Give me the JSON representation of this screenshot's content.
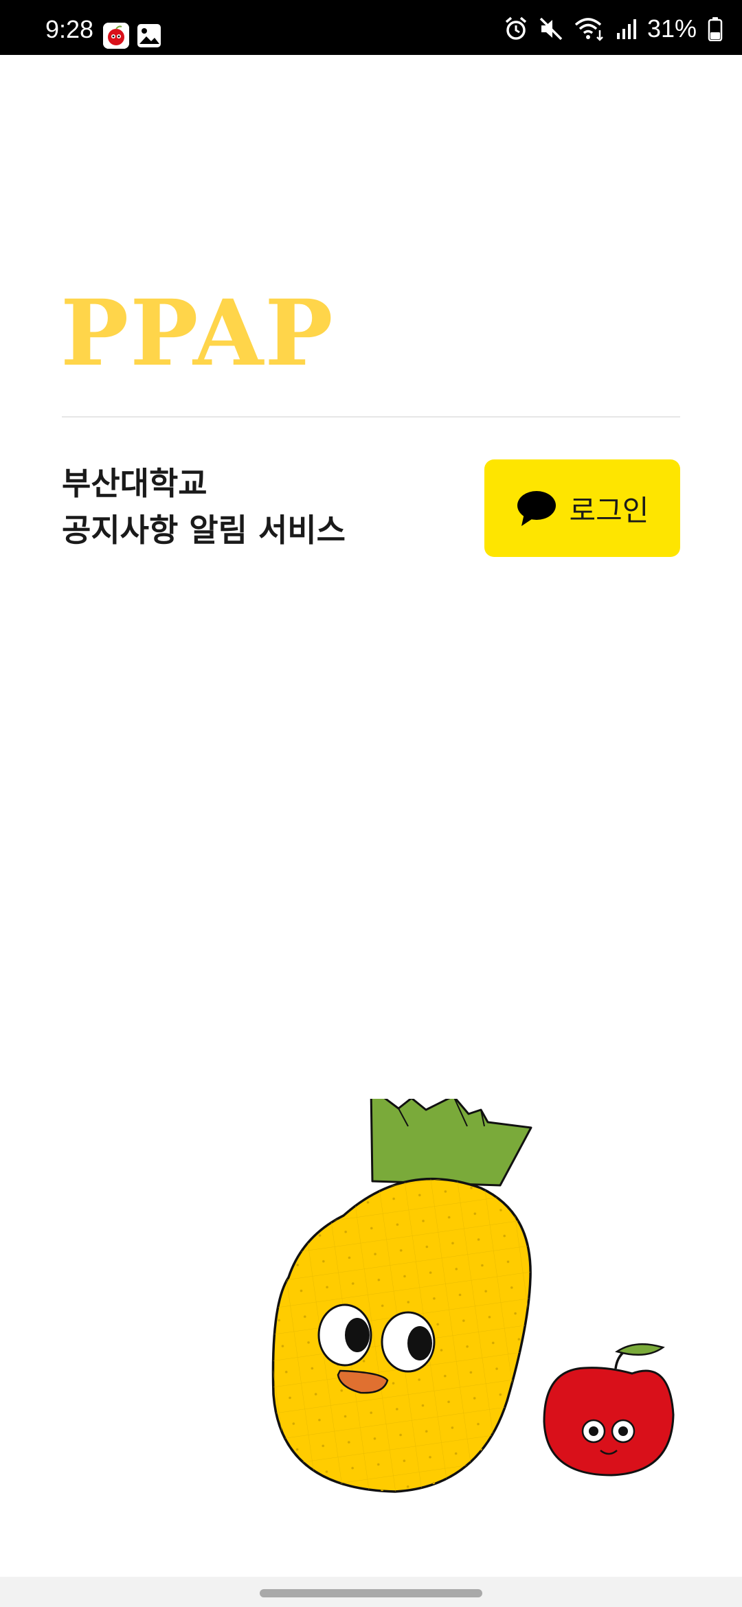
{
  "status_bar": {
    "time": "9:28",
    "battery": "31%",
    "icons": [
      "app-notification-icon",
      "gallery-icon",
      "alarm-icon",
      "mute-icon",
      "wifi-icon",
      "signal-icon",
      "battery-icon"
    ]
  },
  "app": {
    "title": "PPAP",
    "description_line1": "부산대학교",
    "description_line2": "공지사항 알림 서비스"
  },
  "login": {
    "label": "로그인",
    "icon": "chat-bubble-icon"
  },
  "colors": {
    "brand_yellow": "#ffd54a",
    "kakao_yellow": "#fee500",
    "text_dark": "#1a1a1a",
    "pineapple_body": "#ffcc00",
    "pineapple_leaf": "#7aaa3a",
    "apple_red": "#d9101a"
  }
}
